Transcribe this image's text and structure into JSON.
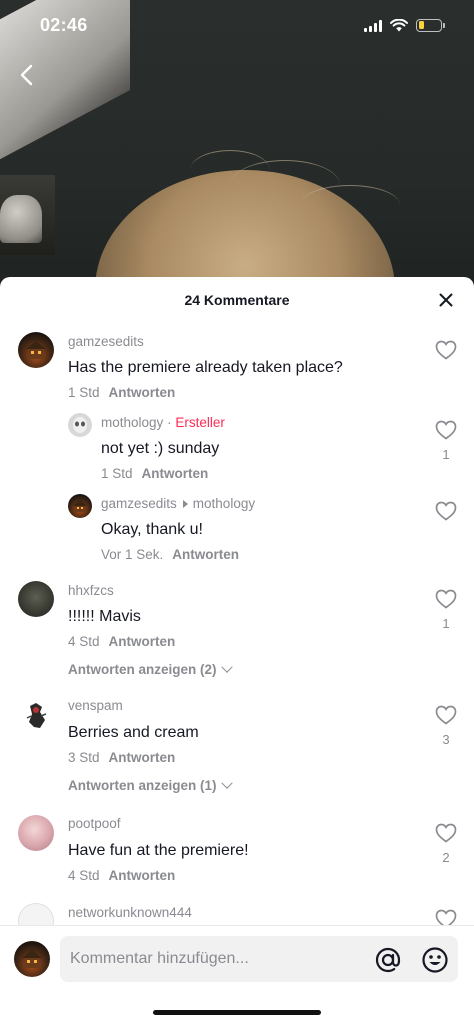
{
  "status_bar": {
    "time": "02:46",
    "battery_color": "#f7d23a",
    "battery_level": 0.25
  },
  "sheet": {
    "title": "24 Kommentare"
  },
  "comments": [
    {
      "username": "gamzesedits",
      "text": "Has the premiere already taken place?",
      "time": "1 Std",
      "reply_label": "Antworten",
      "likes": "",
      "replies": [
        {
          "username": "mothology",
          "separator": "·",
          "creator_badge": "Ersteller",
          "text": "not yet :) sunday",
          "time": "1 Std",
          "reply_label": "Antworten",
          "likes": "1"
        },
        {
          "username": "gamzesedits",
          "reply_to": "mothology",
          "text": "Okay, thank u!",
          "time": "Vor 1 Sek.",
          "reply_label": "Antworten",
          "likes": ""
        }
      ]
    },
    {
      "username": "hhxfzcs",
      "text": "!!!!!! Mavis",
      "time": "4 Std",
      "reply_label": "Antworten",
      "likes": "1",
      "show_replies": "Antworten anzeigen (2)"
    },
    {
      "username": "venspam",
      "text": "Berries and cream",
      "time": "3 Std",
      "reply_label": "Antworten",
      "likes": "3",
      "show_replies": "Antworten anzeigen (1)"
    },
    {
      "username": "pootpoof",
      "text": "Have fun at the premiere!",
      "time": "4 Std",
      "reply_label": "Antworten",
      "likes": "2"
    },
    {
      "username": "networkunknown444"
    }
  ],
  "input": {
    "placeholder": "Kommentar hinzufügen..."
  },
  "colors": {
    "accent": "#fe2c55",
    "secondary_text": "#8a8b91",
    "primary_text": "#161823"
  }
}
